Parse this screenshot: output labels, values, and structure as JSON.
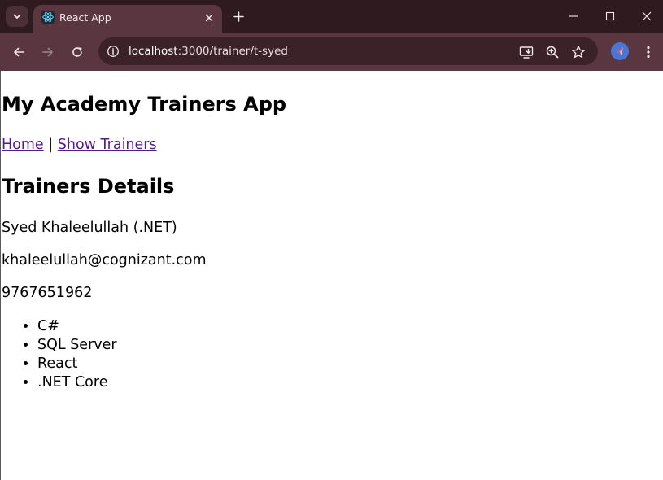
{
  "browser": {
    "tab": {
      "title": "React App",
      "favicon": "react-logo-icon"
    },
    "address_bar": {
      "host": "localhost",
      "path": ":3000/trainer/t-syed"
    },
    "icons": {
      "tab_search": "chevron-down-icon",
      "close_tab": "close-icon",
      "new_tab": "plus-icon",
      "minimize": "minimize-icon",
      "maximize": "maximize-icon",
      "close_window": "close-icon",
      "back": "arrow-left-icon",
      "forward": "arrow-right-icon",
      "reload": "reload-icon",
      "site_info": "info-icon",
      "install_app": "install-app-icon",
      "zoom": "zoom-icon",
      "bookmark": "star-icon",
      "profile": "profile-avatar-icon",
      "menu": "kebab-menu-icon"
    },
    "colors": {
      "tabstrip": "#2f1a1f",
      "toolbar": "#5a3740",
      "omnibox": "#3a2228"
    }
  },
  "page": {
    "app_title": "My Academy Trainers App",
    "nav": {
      "home": "Home",
      "separator": "|",
      "show_trainers": "Show Trainers"
    },
    "section_title": "Trainers Details",
    "trainer": {
      "name_line": "Syed Khaleelullah (.NET)",
      "email": "khaleelullah@cognizant.com",
      "phone": "9767651962",
      "skills": [
        "C#",
        "SQL Server",
        "React",
        ".NET Core"
      ]
    },
    "colors": {
      "visited_link": "#551a8b"
    }
  }
}
